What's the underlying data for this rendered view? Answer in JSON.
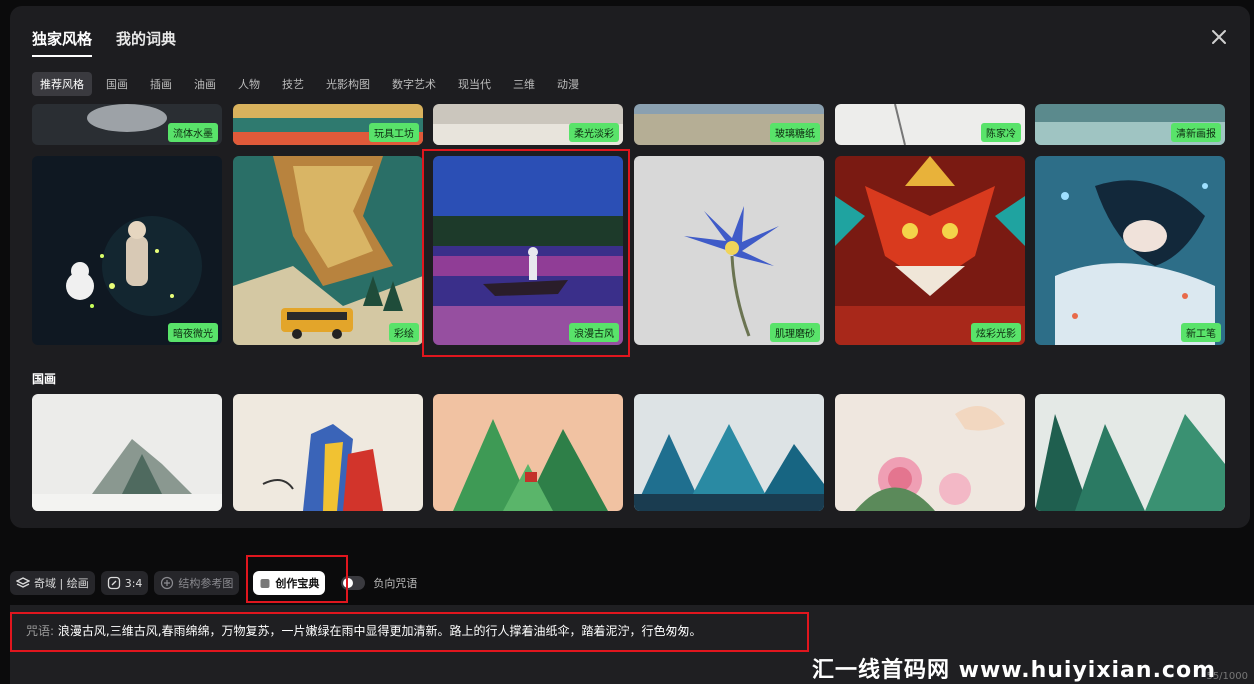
{
  "header": {
    "tabs": [
      {
        "label": "独家风格",
        "active": true
      },
      {
        "label": "我的词典",
        "active": false
      }
    ]
  },
  "categories": [
    "推荐风格",
    "国画",
    "插画",
    "油画",
    "人物",
    "技艺",
    "光影构图",
    "数字艺术",
    "现当代",
    "三维",
    "动漫"
  ],
  "recommended": {
    "row_top_tags": [
      "流体水墨",
      "玩具工坊",
      "柔光淡彩",
      "玻璃糖纸",
      "陈家冷",
      "清新画报"
    ],
    "row_main_tags": [
      "暗夜微光",
      "彩绘",
      "浪漫古风",
      "肌理磨砂",
      "炫彩光影",
      "新工笔"
    ]
  },
  "section_guohua": {
    "label": "国画"
  },
  "toolbar": {
    "model_label": "奇域 | 绘画",
    "ratio_label": "3:4",
    "structure_ref_label": "结构参考图",
    "creation_book_label": "创作宝典",
    "negative_prompt_label": "负向咒语"
  },
  "prompt": {
    "label": "咒语:",
    "text": "浪漫古风,三维古风,春雨绵绵，万物复苏，一片嫩绿在雨中显得更加清新。路上的行人撑着油纸伞，踏着泥泞，行色匆匆。",
    "counter": "55/1000"
  },
  "watermark": "汇一线首码网 www.huiyixian.com",
  "colors": {
    "tag_green": "#59e36a",
    "highlight_red": "#e0161e"
  }
}
